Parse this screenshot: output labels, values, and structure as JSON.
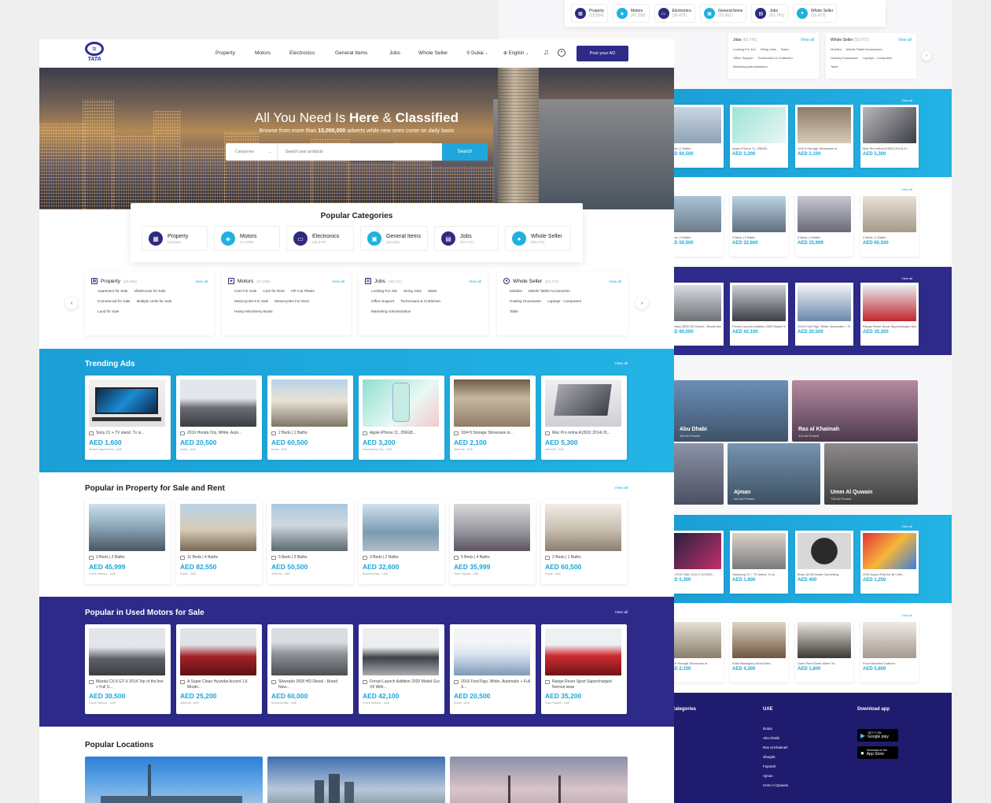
{
  "back": {
    "cats": [
      {
        "label": "Property",
        "count": "(15,554)",
        "icon": "building-icon"
      },
      {
        "label": "Motors",
        "count": "(47,259)",
        "icon": "car-icon"
      },
      {
        "label": "Electronics",
        "count": "(36,475)",
        "icon": "tv-icon"
      },
      {
        "label": "General Items",
        "count": "(23,451)",
        "icon": "box-icon"
      },
      {
        "label": "Jobs",
        "count": "(63,741)",
        "icon": "briefcase-icon"
      },
      {
        "label": "Whole Seller",
        "count": "(53,472)",
        "icon": "user-icon"
      }
    ],
    "jobs_sub": {
      "title": "Jobs",
      "count": "(63,741)",
      "view_all": "View all",
      "items": [
        "Looking For Job",
        "Hiring Jobs",
        "Sales",
        "Office Support",
        "Technicians & Craftsmen",
        "Marketing Administration"
      ]
    },
    "whole_sub": {
      "title": "Whole Seller",
      "count": "(53,472)",
      "view_all": "View all",
      "items": [
        "Mobiles",
        "Mobile Tablet Accessories",
        "Hosting Houseware",
        "Laptops - Computers",
        "Table"
      ]
    },
    "view_all": "View all",
    "trending": [
      {
        "title": "2 Beds | 1 Baths",
        "price": "AED 60,500"
      },
      {
        "title": "Apple iPhone 11, 256GB...",
        "price": "AED 3,200"
      },
      {
        "title": "10/4 ft Storage Showcase in...",
        "price": "AED 2,100"
      },
      {
        "title": "Mac Pro retina A1502( 2014) I5...",
        "price": "AED 5,300"
      }
    ],
    "property": [
      {
        "title": "5 Beds | 3 Baths",
        "price": "AED 50,500"
      },
      {
        "title": "3 Beds | 2 Baths",
        "price": "AED 32,600"
      },
      {
        "title": "5 Beds | 4 Baths",
        "price": "AED 35,999"
      },
      {
        "title": "2 Beds | 1 Baths",
        "price": "AED 60,500"
      }
    ],
    "motors": [
      {
        "title": "Silverado 2500 HD Diesel - Brand New...",
        "price": "AED 60,000"
      },
      {
        "title": "Ferrari Launch Addition 2020 Model Gcc V6 With...",
        "price": "AED 42,100"
      },
      {
        "title": "2016 Ford Figo, White, Automatic + Full S...",
        "price": "AED 20,500"
      },
      {
        "title": "Range Rover Sport Supercharged Normal wear",
        "price": "AED 35,200"
      }
    ],
    "locations": [
      {
        "name": "Abu Dhabi",
        "count": "340 Ad Posted"
      },
      {
        "name": "Ras al Khaimah",
        "count": "410 Ad Posted"
      },
      {
        "name": "Ajman",
        "count": "365 Ad Posted"
      },
      {
        "name": "Umm Al Quwain",
        "count": "736 Ad Posted"
      }
    ],
    "electronics": [
      {
        "title": "Asus ROG Strix G15 i7-10750H...",
        "price": "AED 5,300"
      },
      {
        "title": "Samsung 21 + TV stand. Tv is...",
        "price": "AED 1,600"
      },
      {
        "title": "Bose QC35 Noise Cancelling...",
        "price": "AED 400"
      },
      {
        "title": "2020 Apple iPad Air 4th Gen...",
        "price": "AED 1,250"
      }
    ],
    "furniture": [
      {
        "title": "10/4 ft Storage Showcase in...",
        "price": "AED 2,100"
      },
      {
        "title": "Solid Mahogany Wood Bed...",
        "price": "AED 4,300"
      },
      {
        "title": "Used Pure Down Warm To...",
        "price": "AED 1,600"
      },
      {
        "title": "Floor Mounted Cabinet...",
        "price": "AED 5,800"
      }
    ],
    "footer": {
      "categories": "Categories",
      "uae": "UAE",
      "cities": [
        "Dubai",
        "Abu Dhabi",
        "Ras al Khaimah",
        "Sharjah",
        "Fujairah",
        "Ajman",
        "Umm Al Quwain"
      ],
      "download": "Download app",
      "google_small": "GET IT ON",
      "google": "Google play",
      "apple_small": "Download on the",
      "apple": "App Store"
    }
  },
  "nav": {
    "logo": "TATA",
    "links": [
      "Property",
      "Motors",
      "Electronics",
      "General Items",
      "Jobs",
      "Whole Seller"
    ],
    "location": "Dubai",
    "language": "English",
    "post": "Post your AD"
  },
  "hero": {
    "title_a": "All You Need Is ",
    "title_b": "Here",
    "title_c": " & ",
    "title_d": "Classified",
    "sub_a": "Browse from more than ",
    "sub_b": "15,000,000",
    "sub_c": " adverts while new ones come on daily basis",
    "category": "Categories",
    "placeholder": "Search your products",
    "search": "Search"
  },
  "popular_categories": {
    "title": "Popular Categories",
    "items": [
      {
        "label": "Property",
        "count": "(15,554)"
      },
      {
        "label": "Motors",
        "count": "(47,259)"
      },
      {
        "label": "Electronics",
        "count": "(36,475)"
      },
      {
        "label": "General Items",
        "count": "(23,451)"
      },
      {
        "label": "Jobs",
        "count": "(63,741)"
      },
      {
        "label": "Whole Seller",
        "count": "(53,472)"
      }
    ]
  },
  "subcats": [
    {
      "title": "Property",
      "count": "(15,554)",
      "view_all": "View all",
      "rows": [
        [
          "Apartment for Sale",
          "Villa/House for Sale"
        ],
        [
          "Commercial for Sale",
          "Multiple Units for Sale"
        ],
        [
          "Land for Sale"
        ]
      ]
    },
    {
      "title": "Motors",
      "count": "(47,259)",
      "view_all": "View all",
      "rows": [
        [
          "Cars For Sale",
          "Cars for Rent",
          "VIP Car Plates"
        ],
        [
          "Motorcycles For Sale",
          "Motorcycles For Rent"
        ],
        [
          "Heavy Machinery Boats"
        ]
      ]
    },
    {
      "title": "Jobs",
      "count": "(63,741)",
      "view_all": "View all",
      "rows": [
        [
          "Looking For Job",
          "Hiring Jobs",
          "Sales"
        ],
        [
          "Office Support",
          "Technicians & Craftsmen"
        ],
        [
          "Marketing Administration"
        ]
      ]
    },
    {
      "title": "Whole Seller",
      "count": "(53,472)",
      "view_all": "View all",
      "rows": [
        [
          "Mobiles",
          "Mobile Tablet Accessories"
        ],
        [
          "Hosting Houseware",
          "Laptops - Computers"
        ],
        [
          "Table"
        ]
      ]
    }
  ],
  "trending": {
    "title": "Trending Ads",
    "view_all": "View all",
    "items": [
      {
        "title": "Sony 21 + TV stand. Tv is...",
        "price": "AED 1,600",
        "location": "Sheikh Zayed Road - UAE"
      },
      {
        "title": "2016 Honda City, White, Auto...",
        "price": "AED 20,500",
        "location": "Dubai - UAE"
      },
      {
        "title": "2 Beds | 1 Baths",
        "price": "AED 60,500",
        "location": "Dubai - UAE"
      },
      {
        "title": "Apple iPhone 11, 256GB...",
        "price": "AED 3,200",
        "location": "International City - UAE"
      },
      {
        "title": "10/4 ft Storage Showcase in...",
        "price": "AED 2,100",
        "location": "Jebel Ali - UAE"
      },
      {
        "title": "Mac Pro retina A1502( 2014) I5...",
        "price": "AED 5,300",
        "location": "Jebel Ali - UAE"
      }
    ]
  },
  "property": {
    "title": "Popular in Property for Sale and Rent",
    "view_all": "View all",
    "items": [
      {
        "title": "3 Beds | 2 Baths",
        "price": "AED 45,999",
        "location": "Creek Harbour - UAE"
      },
      {
        "title": "11 Beds | 4 Baths",
        "price": "AED 82,550",
        "location": "Dubai - UAE"
      },
      {
        "title": "5 Beds | 3 Baths",
        "price": "AED 50,500",
        "location": "Jebel Ali - UAE"
      },
      {
        "title": "3 Beds | 2 Baths",
        "price": "AED 32,600",
        "location": "Business Bay - UAE"
      },
      {
        "title": "5 Beds | 4 Baths",
        "price": "AED 35,999",
        "location": "Town Square - UAE"
      },
      {
        "title": "2 Beds | 1 Baths",
        "price": "AED 60,500",
        "location": "Dubai - UAE"
      }
    ]
  },
  "motors": {
    "title": "Popular in Used Motors for Sale",
    "view_all": "View all",
    "items": [
      {
        "title": "Mazda CX-5 GT-X 2014 Top of the line + Full S...",
        "price": "AED 30,500",
        "location": "Creek Harbour - UAE"
      },
      {
        "title": "A Super Clean Hyundai Accent 1.6 Model...",
        "price": "AED 25,200",
        "location": "Jebel Ali - UAE"
      },
      {
        "title": "Silverado 2500 HD Diesel - Brand New...",
        "price": "AED 60,000",
        "location": "Business Bay - UAE"
      },
      {
        "title": "Ferrari Launch Addition 2020 Model Gcc V6 With...",
        "price": "AED 42,100",
        "location": "Creek Harbour - UAE"
      },
      {
        "title": "2016 Ford Figo, White, Automatic + Full S...",
        "price": "AED 20,500",
        "location": "Dubai - UAE"
      },
      {
        "title": "Range Rover Sport Supercharged Normal wear",
        "price": "AED 35,200",
        "location": "Town Square - UAE"
      }
    ]
  },
  "locations_title": "Popular Locations",
  "colors": {
    "primary": "#2d2a8a",
    "accent": "#1fa7dc",
    "price": "#1aa4d6"
  }
}
